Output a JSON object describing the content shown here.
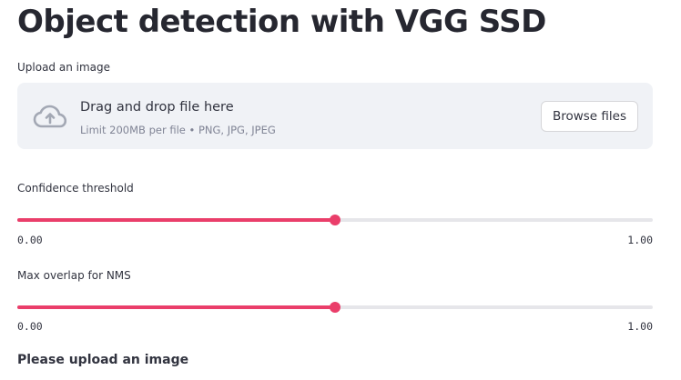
{
  "page": {
    "title": "Object detection with VGG SSD"
  },
  "uploader": {
    "label": "Upload an image",
    "dropzone_text": "Drag and drop file here",
    "limit_text": "Limit 200MB per file • PNG, JPG, JPEG",
    "browse_label": "Browse files",
    "icon": "cloud-upload-icon"
  },
  "sliders": [
    {
      "label": "Confidence threshold",
      "min_label": "0.00",
      "max_label": "1.00",
      "min": 0.0,
      "max": 1.0,
      "value": 0.5
    },
    {
      "label": "Max overlap for NMS",
      "min_label": "0.00",
      "max_label": "1.00",
      "min": 0.0,
      "max": 1.0,
      "value": 0.5
    }
  ],
  "status": {
    "message": "Please upload an image"
  },
  "colors": {
    "accent": "#ea3e6a",
    "track": "#e6e6ea",
    "dropzone_bg": "#f0f2f6",
    "text": "#31333f",
    "muted_text": "#808495"
  }
}
